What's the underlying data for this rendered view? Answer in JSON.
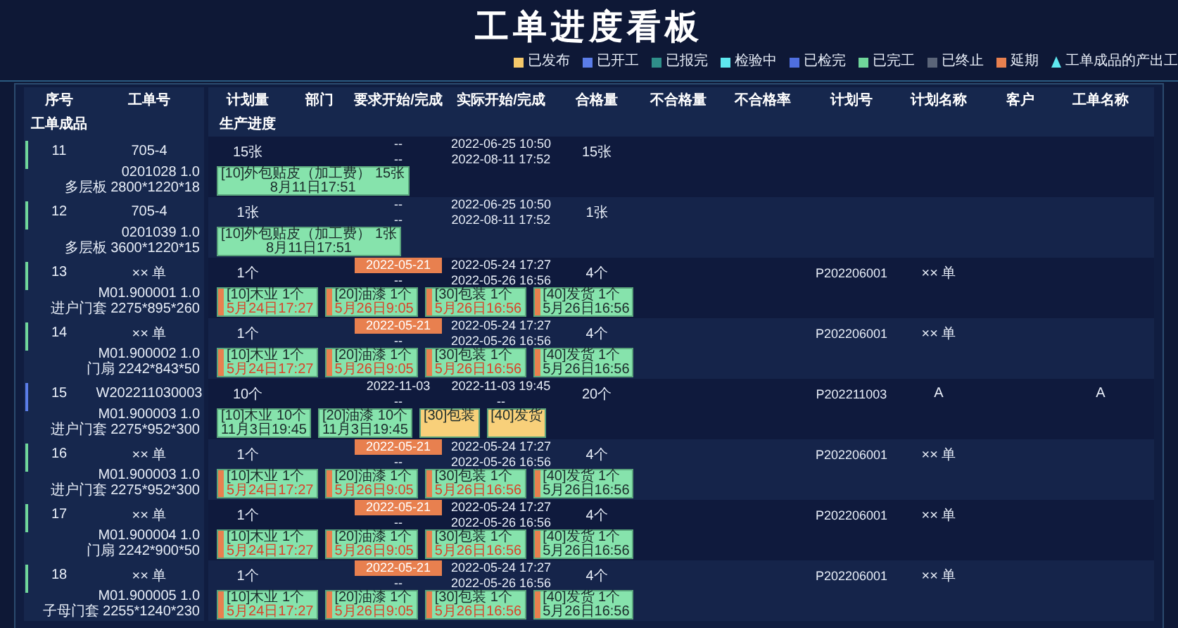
{
  "title": "工单进度看板",
  "legend": [
    {
      "label": "已发布",
      "color": "#f5c86a",
      "kind": "square"
    },
    {
      "label": "已开工",
      "color": "#5b7de8",
      "kind": "square"
    },
    {
      "label": "已报完",
      "color": "#2f8f8a",
      "kind": "square"
    },
    {
      "label": "检验中",
      "color": "#5ee8f0",
      "kind": "square"
    },
    {
      "label": "已检完",
      "color": "#4f6fe0",
      "kind": "square"
    },
    {
      "label": "已完工",
      "color": "#6fd69a",
      "kind": "square"
    },
    {
      "label": "已终止",
      "color": "#5a6478",
      "kind": "square"
    },
    {
      "label": "延期",
      "color": "#e8804f",
      "kind": "square"
    },
    {
      "label": "工单成品的产出工",
      "color": "#5ee8f0",
      "kind": "triangle"
    }
  ],
  "table": {
    "columns": [
      "序号",
      "工单号",
      "计划量",
      "部门",
      "要求开始/完成",
      "实际开始/完成",
      "合格量",
      "不合格量",
      "不合格率",
      "计划号",
      "计划名称",
      "客户",
      "工单名称"
    ],
    "sub_columns": [
      "工单成品",
      "生产进度"
    ],
    "rows": [
      {
        "seq": "11",
        "work_order": "705-4",
        "color": "#6fd69a",
        "product_code": "0201028  1.0",
        "product_spec": "多层板  2800*1220*18",
        "plan_qty": "15张",
        "required": {
          "start": "--",
          "end": "--",
          "delayed": false
        },
        "actual_start": "2022-06-25 10:50",
        "actual_end": "2022-08-11 17:52",
        "qualified_qty": "15张",
        "steps": [
          {
            "label": "[10]外包贴皮（加工费） 15张",
            "time": "8月11日17:51",
            "color": "#86e3ac",
            "delayed": false,
            "overdue": false
          }
        ]
      },
      {
        "seq": "12",
        "work_order": "705-4",
        "color": "#6fd69a",
        "product_code": "0201039  1.0",
        "product_spec": "多层板  3600*1220*15",
        "plan_qty": "1张",
        "required": {
          "start": "--",
          "end": "--",
          "delayed": false
        },
        "actual_start": "2022-06-25 10:50",
        "actual_end": "2022-08-11 17:52",
        "qualified_qty": "1张",
        "steps": [
          {
            "label": "[10]外包贴皮（加工费） 1张",
            "time": "8月11日17:51",
            "color": "#86e3ac",
            "delayed": false,
            "overdue": false
          }
        ]
      },
      {
        "seq": "13",
        "work_order": "×× 单",
        "color": "#6fd69a",
        "product_code": "M01.900001  1.0",
        "product_spec": "进户门套  2275*895*260",
        "plan_qty": "1个",
        "required": {
          "start": "2022-05-21",
          "end": "--",
          "delayed": true
        },
        "actual_start": "2022-05-24 17:27",
        "actual_end": "2022-05-26 16:56",
        "qualified_qty": "4个",
        "plan_no": "P202206001",
        "plan_name": "×× 单",
        "steps": [
          {
            "label": "[10]木业 1个",
            "time": "5月24日17:27",
            "color": "#86e3ac",
            "delayed": true,
            "overdue": true
          },
          {
            "label": "[20]油漆 1个",
            "time": "5月26日9:05",
            "color": "#86e3ac",
            "delayed": true,
            "overdue": true
          },
          {
            "label": "[30]包装 1个",
            "time": "5月26日16:56",
            "color": "#86e3ac",
            "delayed": true,
            "overdue": true
          },
          {
            "label": "[40]发货 1个",
            "time": "5月26日16:56",
            "color": "#86e3ac",
            "delayed": true,
            "overdue": false
          }
        ]
      },
      {
        "seq": "14",
        "work_order": "×× 单",
        "color": "#6fd69a",
        "product_code": "M01.900002  1.0",
        "product_spec": "门扇  2242*843*50",
        "plan_qty": "1个",
        "required": {
          "start": "2022-05-21",
          "end": "--",
          "delayed": true
        },
        "actual_start": "2022-05-24 17:27",
        "actual_end": "2022-05-26 16:56",
        "qualified_qty": "4个",
        "plan_no": "P202206001",
        "plan_name": "×× 单",
        "steps": [
          {
            "label": "[10]木业 1个",
            "time": "5月24日17:27",
            "color": "#86e3ac",
            "delayed": true,
            "overdue": true
          },
          {
            "label": "[20]油漆 1个",
            "time": "5月26日9:05",
            "color": "#86e3ac",
            "delayed": true,
            "overdue": true
          },
          {
            "label": "[30]包装 1个",
            "time": "5月26日16:56",
            "color": "#86e3ac",
            "delayed": true,
            "overdue": true
          },
          {
            "label": "[40]发货 1个",
            "time": "5月26日16:56",
            "color": "#86e3ac",
            "delayed": true,
            "overdue": false
          }
        ]
      },
      {
        "seq": "15",
        "work_order": "W202211030003",
        "color": "#5b7de8",
        "product_code": "M01.900003  1.0",
        "product_spec": "进户门套  2275*952*300",
        "plan_qty": "10个",
        "required": {
          "start": "2022-11-03",
          "end": "--",
          "delayed": false
        },
        "actual_start": "2022-11-03 19:45",
        "actual_end": "--",
        "qualified_qty": "20个",
        "plan_no": "P202211003",
        "plan_name": "A",
        "work_order_name": "A",
        "steps": [
          {
            "label": "[10]木业 10个",
            "time": "11月3日19:45",
            "color": "#86e3ac",
            "delayed": false,
            "overdue": false
          },
          {
            "label": "[20]油漆 10个",
            "time": "11月3日19:45",
            "color": "#86e3ac",
            "delayed": false,
            "overdue": false
          },
          {
            "label": "[30]包装",
            "color": "#f8d07a",
            "delayed": false
          },
          {
            "label": "[40]发货",
            "color": "#f8d07a",
            "delayed": false
          }
        ]
      },
      {
        "seq": "16",
        "work_order": "×× 单",
        "color": "#6fd69a",
        "product_code": "M01.900003  1.0",
        "product_spec": "进户门套  2275*952*300",
        "plan_qty": "1个",
        "required": {
          "start": "2022-05-21",
          "end": "--",
          "delayed": true
        },
        "actual_start": "2022-05-24 17:27",
        "actual_end": "2022-05-26 16:56",
        "qualified_qty": "4个",
        "plan_no": "P202206001",
        "plan_name": "×× 单",
        "steps": [
          {
            "label": "[10]木业 1个",
            "time": "5月24日17:27",
            "color": "#86e3ac",
            "delayed": true,
            "overdue": true
          },
          {
            "label": "[20]油漆 1个",
            "time": "5月26日9:05",
            "color": "#86e3ac",
            "delayed": true,
            "overdue": true
          },
          {
            "label": "[30]包装 1个",
            "time": "5月26日16:56",
            "color": "#86e3ac",
            "delayed": true,
            "overdue": true
          },
          {
            "label": "[40]发货 1个",
            "time": "5月26日16:56",
            "color": "#86e3ac",
            "delayed": true,
            "overdue": false
          }
        ]
      },
      {
        "seq": "17",
        "work_order": "×× 单",
        "color": "#6fd69a",
        "product_code": "M01.900004  1.0",
        "product_spec": "门扇  2242*900*50",
        "plan_qty": "1个",
        "required": {
          "start": "2022-05-21",
          "end": "--",
          "delayed": true
        },
        "actual_start": "2022-05-24 17:27",
        "actual_end": "2022-05-26 16:56",
        "qualified_qty": "4个",
        "plan_no": "P202206001",
        "plan_name": "×× 单",
        "steps": [
          {
            "label": "[10]木业 1个",
            "time": "5月24日17:27",
            "color": "#86e3ac",
            "delayed": true,
            "overdue": true
          },
          {
            "label": "[20]油漆 1个",
            "time": "5月26日9:05",
            "color": "#86e3ac",
            "delayed": true,
            "overdue": true
          },
          {
            "label": "[30]包装 1个",
            "time": "5月26日16:56",
            "color": "#86e3ac",
            "delayed": true,
            "overdue": true
          },
          {
            "label": "[40]发货 1个",
            "time": "5月26日16:56",
            "color": "#86e3ac",
            "delayed": true,
            "overdue": false
          }
        ]
      },
      {
        "seq": "18",
        "work_order": "×× 单",
        "color": "#6fd69a",
        "product_code": "M01.900005  1.0",
        "product_spec": "子母门套  2255*1240*230",
        "plan_qty": "1个",
        "required": {
          "start": "2022-05-21",
          "end": "--",
          "delayed": true
        },
        "actual_start": "2022-05-24 17:27",
        "actual_end": "2022-05-26 16:56",
        "qualified_qty": "4个",
        "plan_no": "P202206001",
        "plan_name": "×× 单",
        "steps": [
          {
            "label": "[10]木业 1个",
            "time": "5月24日17:27",
            "color": "#86e3ac",
            "delayed": true,
            "overdue": true
          },
          {
            "label": "[20]油漆 1个",
            "time": "5月26日9:05",
            "color": "#86e3ac",
            "delayed": true,
            "overdue": true
          },
          {
            "label": "[30]包装 1个",
            "time": "5月26日16:56",
            "color": "#86e3ac",
            "delayed": true,
            "overdue": true
          },
          {
            "label": "[40]发货 1个",
            "time": "5月26日16:56",
            "color": "#86e3ac",
            "delayed": true,
            "overdue": false
          }
        ]
      }
    ]
  }
}
